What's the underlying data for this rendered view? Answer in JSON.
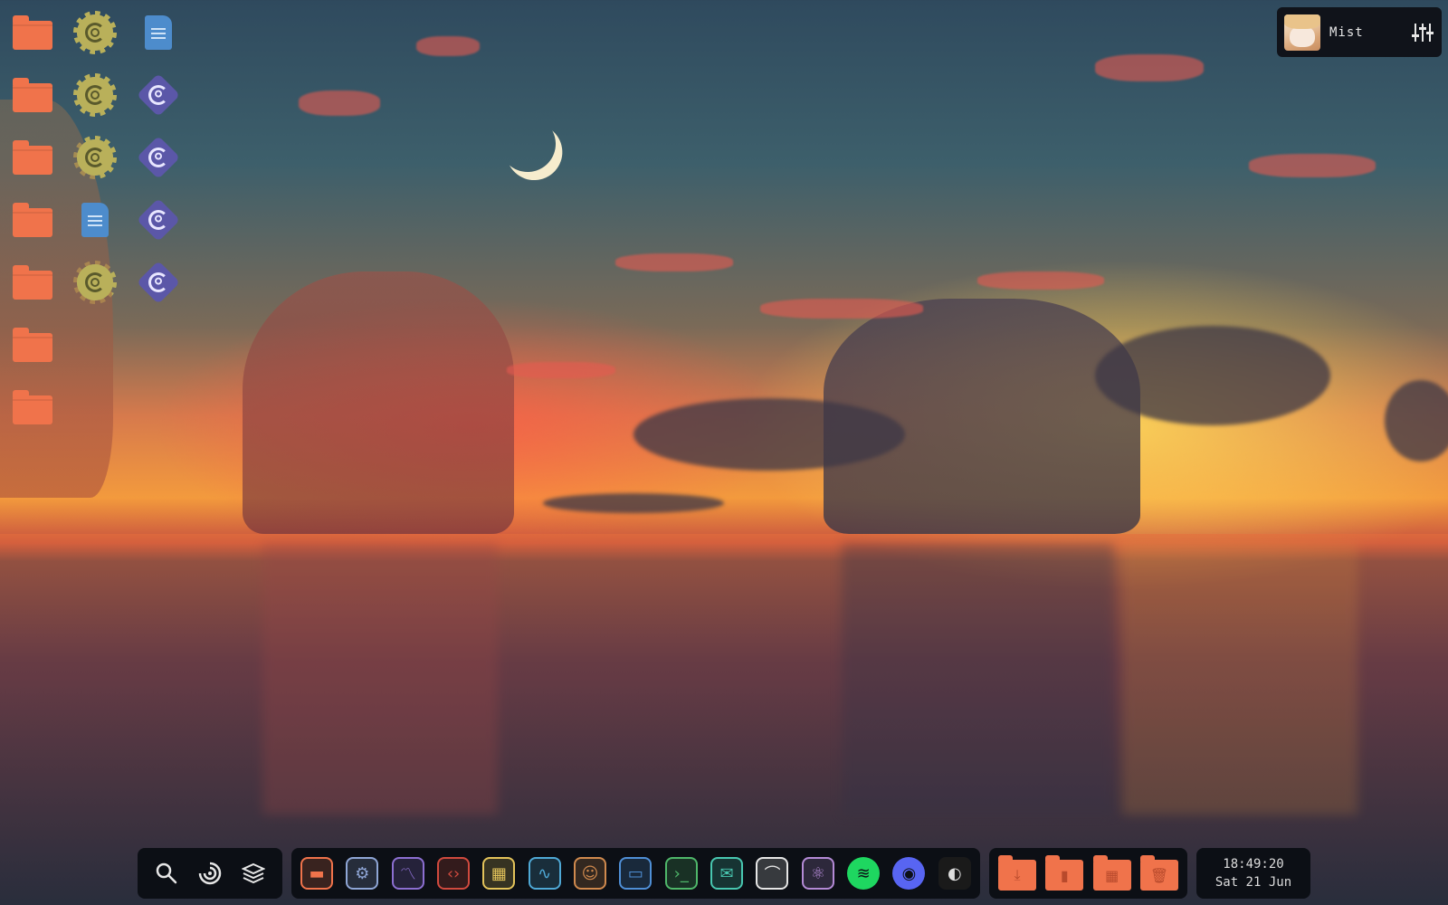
{
  "desktop": {
    "icons_col1": [
      {
        "type": "folder-icon"
      },
      {
        "type": "folder-icon"
      },
      {
        "type": "folder-icon"
      },
      {
        "type": "folder-icon"
      },
      {
        "type": "folder-icon"
      },
      {
        "type": "folder-icon"
      },
      {
        "type": "folder-icon"
      }
    ],
    "icons_col2": [
      {
        "type": "settings-app-icon"
      },
      {
        "type": "settings-app-icon"
      },
      {
        "type": "settings-app-icon"
      },
      {
        "type": "document-icon"
      },
      {
        "type": "settings-app-icon"
      }
    ],
    "icons_col3": [
      {
        "type": "document-icon"
      },
      {
        "type": "update-app-icon"
      },
      {
        "type": "update-app-icon"
      },
      {
        "type": "update-app-icon"
      },
      {
        "type": "update-app-icon"
      }
    ]
  },
  "user_panel": {
    "name": "Mist",
    "settings_icon": "sliders-icon"
  },
  "taskbar": {
    "tools": [
      "search-icon",
      "launcher-icon",
      "layers-icon"
    ],
    "apps": [
      {
        "name": "files-app-icon",
        "color": "#f0734b"
      },
      {
        "name": "settings-app-icon",
        "color": "#8fa6d6"
      },
      {
        "name": "monitor-app-icon",
        "color": "#8c6fd1"
      },
      {
        "name": "code-editor-icon",
        "color": "#d04a3e"
      },
      {
        "name": "app-store-icon",
        "color": "#e3c35a"
      },
      {
        "name": "system-monitor-icon",
        "color": "#4fa9d6"
      },
      {
        "name": "contacts-icon",
        "color": "#d08a4e"
      },
      {
        "name": "chat-icon",
        "color": "#4f8fd6"
      },
      {
        "name": "terminal-icon",
        "color": "#4fb76a"
      },
      {
        "name": "mail-icon",
        "color": "#48c7b0"
      },
      {
        "name": "brush-icon",
        "color": "#e6e6e6"
      },
      {
        "name": "atom-icon",
        "color": "#b48ad6"
      },
      {
        "name": "spotify-icon",
        "color": "#1ed760"
      },
      {
        "name": "discord-icon",
        "color": "#5865f2"
      },
      {
        "name": "panda-app-icon",
        "color": "#dddddd"
      }
    ],
    "folders": [
      "downloads-folder-icon",
      "documents-folder-icon",
      "apps-folder-icon",
      "trash-folder-icon"
    ],
    "clock": {
      "time": "18:49:20",
      "date": "Sat 21 Jun"
    }
  }
}
